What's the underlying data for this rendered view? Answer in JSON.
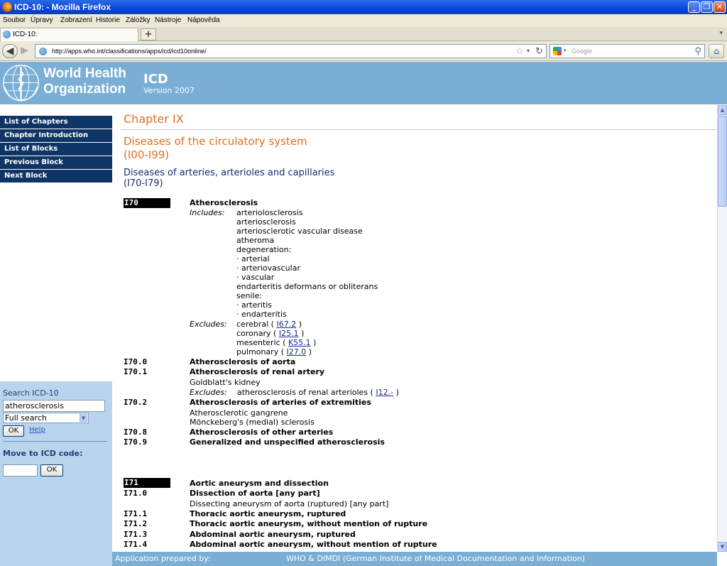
{
  "window": {
    "title": "ICD-10: - Mozilla Firefox",
    "minimize": "_",
    "maximize": "❐",
    "close": "✕"
  },
  "menubar": [
    "Soubor",
    "Úpravy",
    "Zobrazení",
    "Historie",
    "Záložky",
    "Nástroje",
    "Nápověda"
  ],
  "tab": {
    "label": "ICD-10:",
    "new_tab": "+"
  },
  "navbar": {
    "url": "http://apps.who.int/classifications/apps/icd/icd10online/",
    "search_placeholder": "Google"
  },
  "header": {
    "org_line1": "World Health",
    "org_line2": "Organization",
    "app_title": "ICD",
    "version": "Version 2007"
  },
  "sidebar": {
    "nav": [
      "List of Chapters",
      "Chapter Introduction",
      "List of Blocks",
      "Previous Block",
      "Next Block"
    ],
    "search_heading": "Search ICD-10",
    "search_value": "atherosclerosis",
    "search_mode": "Full search",
    "ok_label": "OK",
    "help_label": "Help",
    "move_heading": "Move to ICD code:",
    "move_ok_label": "OK"
  },
  "content": {
    "chapter": "Chapter IX",
    "chapter_title_1": "Diseases of the circulatory system",
    "chapter_title_2": "(I00-I99)",
    "block_title_1": "Diseases of arteries, arterioles and capillaries",
    "block_title_2": "(I70-I79)",
    "i70": {
      "code": "I70",
      "title": "Atherosclerosis",
      "includes_label": "Includes:",
      "includes": [
        "arteriolosclerosis",
        "arteriosclerosis",
        "arteriosclerotic vascular disease",
        "atheroma",
        "degeneration:",
        "· arterial",
        "· arteriovascular",
        "· vascular",
        "endarteritis deformans or obliterans",
        "senile:",
        "· arteritis",
        "· endarteritis"
      ],
      "excludes_label": "Excludes:",
      "excludes": [
        {
          "text": "cerebral",
          "ref": "I67.2"
        },
        {
          "text": "coronary",
          "ref": "I25.1"
        },
        {
          "text": "mesenteric",
          "ref": "K55.1"
        },
        {
          "text": "pulmonary",
          "ref": "I27.0"
        }
      ]
    },
    "i70_sub": {
      "i70_0_code": "I70.0",
      "i70_0_title": "Atherosclerosis of aorta",
      "i70_1_code": "I70.1",
      "i70_1_title": "Atherosclerosis of renal artery",
      "i70_1_inc": "Goldblatt's kidney",
      "i70_1_exc_label": "Excludes:",
      "i70_1_exc_text": "atherosclerosis of renal arterioles",
      "i70_1_exc_ref": "I12.-",
      "i70_2_code": "I70.2",
      "i70_2_title": "Atherosclerosis of arteries of extremities",
      "i70_2_inc1": "Atherosclerotic gangrene",
      "i70_2_inc2": "Mönckeberg's (medial) sclerosis",
      "i70_8_code": "I70.8",
      "i70_8_title": "Atherosclerosis of other arteries",
      "i70_9_code": "I70.9",
      "i70_9_title": "Generalized and unspecified atherosclerosis"
    },
    "i71": {
      "code": "I71",
      "title": "Aortic aneurysm and dissection",
      "i71_0_code": "I71.0",
      "i71_0_title": "Dissection of aorta [any part]",
      "i71_0_inc": "Dissecting aneurysm of aorta (ruptured) [any part]",
      "i71_1_code": "I71.1",
      "i71_1_title": "Thoracic aortic aneurysm, ruptured",
      "i71_2_code": "I71.2",
      "i71_2_title": "Thoracic aortic aneurysm, without mention of rupture",
      "i71_3_code": "I71.3",
      "i71_3_title": "Abdominal aortic aneurysm, ruptured",
      "i71_4_code": "I71.4",
      "i71_4_title": "Abdominal aortic aneurysm, without mention of rupture"
    }
  },
  "footer": {
    "left": "Application prepared by:",
    "right": "WHO & DIMDI (German Institute of Medical Documentation and Information)"
  }
}
